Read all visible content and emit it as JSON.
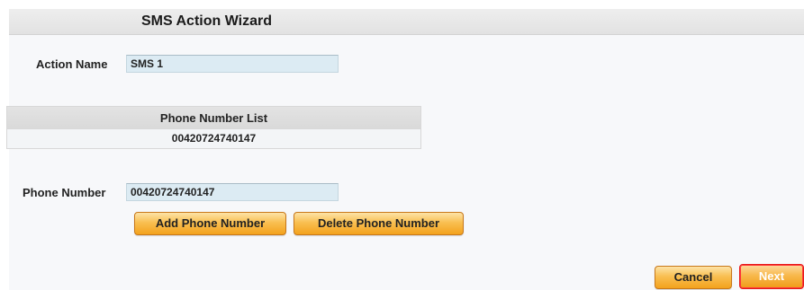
{
  "wizard": {
    "title": "SMS Action Wizard"
  },
  "action_name": {
    "label": "Action Name",
    "value": "SMS 1"
  },
  "phone_list": {
    "header": "Phone Number List",
    "items": [
      "00420724740147"
    ]
  },
  "phone_number": {
    "label": "Phone Number",
    "value": "00420724740147"
  },
  "buttons": {
    "add_phone": "Add Phone Number",
    "delete_phone": "Delete Phone Number",
    "cancel": "Cancel",
    "next": "Next"
  },
  "colors": {
    "button_orange": "#f9bf52",
    "next_border": "#e41b1b",
    "input_bg": "#dcebf3"
  }
}
